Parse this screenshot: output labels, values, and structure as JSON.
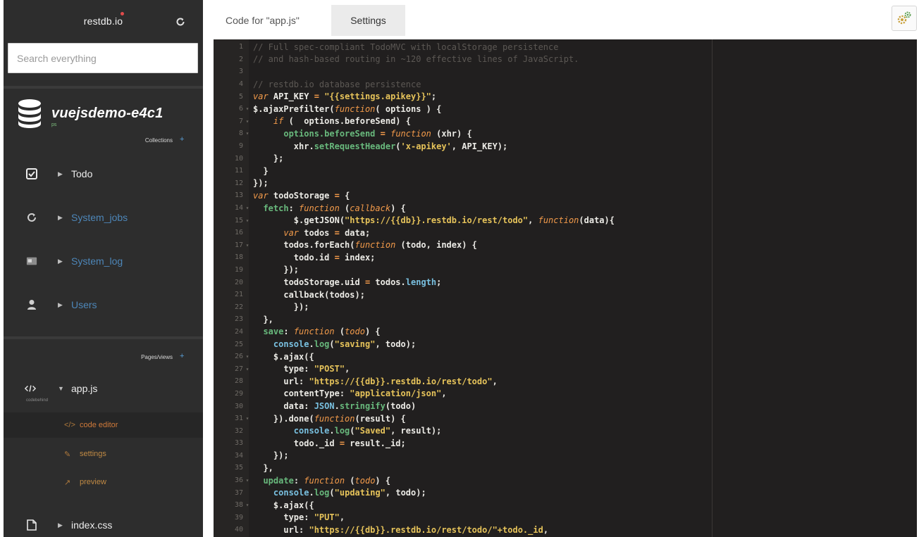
{
  "sidebar": {
    "brand": "restdb.io",
    "search_placeholder": "Search everything",
    "database": {
      "name": "vuejsdemo-e4c1",
      "sub": "ps"
    },
    "collections_label": "Collections",
    "collections": [
      {
        "label": "Todo",
        "icon": "checkbox-icon",
        "dim": false
      },
      {
        "label": "System_jobs",
        "icon": "refresh-icon",
        "dim": true
      },
      {
        "label": "System_log",
        "icon": "log-icon",
        "dim": true
      },
      {
        "label": "Users",
        "icon": "user-icon",
        "dim": true
      }
    ],
    "pages_label": "Pages/views",
    "page": {
      "label": "app.js",
      "sub": "codebehind",
      "icon": "code-icon"
    },
    "page_subitems": [
      {
        "label": "code editor",
        "icon": "code-small-icon",
        "glyph": "</>",
        "active": true
      },
      {
        "label": "settings",
        "icon": "wrench-icon",
        "glyph": "✎",
        "active": false
      },
      {
        "label": "preview",
        "icon": "external-link-icon",
        "glyph": "↗",
        "active": false
      }
    ],
    "file": {
      "label": "index.css",
      "icon": "file-icon"
    }
  },
  "tabs": [
    {
      "label": "Code for \"app.js\"",
      "active": false
    },
    {
      "label": "Settings",
      "active": true
    }
  ],
  "toolbar": {
    "icon": "gears-icon"
  },
  "editor": {
    "lines": [
      [
        [
          "t-comment",
          "// Full spec-compliant TodoMVC with localStorage persistence"
        ]
      ],
      [
        [
          "t-comment",
          "// and hash-based routing in ~120 effective lines of JavaScript."
        ]
      ],
      [],
      [
        [
          "t-comment",
          "// restdb.io database persistence"
        ]
      ],
      [
        [
          "t-keyword",
          "var"
        ],
        [
          "t-plain",
          " API_KEY "
        ],
        [
          "t-op",
          "="
        ],
        [
          "t-plain",
          " "
        ],
        [
          "t-string",
          "\"{{settings.apikey}}\""
        ],
        [
          "t-plain",
          ";"
        ]
      ],
      [
        [
          "t-plain",
          "$.ajaxPrefilter("
        ],
        [
          "t-keyword",
          "function"
        ],
        [
          "t-plain",
          "( options ) {"
        ]
      ],
      [
        [
          "t-plain",
          "    "
        ],
        [
          "t-keyword",
          "if"
        ],
        [
          "t-plain",
          " (  options.beforeSend) {"
        ]
      ],
      [
        [
          "t-plain",
          "      "
        ],
        [
          "t-prop",
          "options.beforeSend"
        ],
        [
          "t-plain",
          " "
        ],
        [
          "t-op",
          "="
        ],
        [
          "t-plain",
          " "
        ],
        [
          "t-keyword",
          "function"
        ],
        [
          "t-plain",
          " (xhr) {"
        ]
      ],
      [
        [
          "t-plain",
          "        xhr."
        ],
        [
          "t-prop",
          "setRequestHeader"
        ],
        [
          "t-plain",
          "("
        ],
        [
          "t-string",
          "'x-apikey'"
        ],
        [
          "t-plain",
          ", API_KEY);"
        ]
      ],
      [
        [
          "t-plain",
          "    };"
        ]
      ],
      [
        [
          "t-plain",
          "  }"
        ]
      ],
      [
        [
          "t-plain",
          "});"
        ]
      ],
      [
        [
          "t-keyword",
          "var"
        ],
        [
          "t-plain",
          " todoStorage "
        ],
        [
          "t-op",
          "="
        ],
        [
          "t-plain",
          " {"
        ]
      ],
      [
        [
          "t-plain",
          "  "
        ],
        [
          "t-prop",
          "fetch"
        ],
        [
          "t-plain",
          ": "
        ],
        [
          "t-keyword",
          "function"
        ],
        [
          "t-plain",
          " ("
        ],
        [
          "t-keyword",
          "callback"
        ],
        [
          "t-plain",
          ") {"
        ]
      ],
      [
        [
          "t-plain",
          "        $.getJSON("
        ],
        [
          "t-string",
          "\"https://{{db}}.restdb.io/rest/todo\""
        ],
        [
          "t-plain",
          ", "
        ],
        [
          "t-keyword",
          "function"
        ],
        [
          "t-plain",
          "(data){"
        ]
      ],
      [
        [
          "t-plain",
          "      "
        ],
        [
          "t-keyword",
          "var"
        ],
        [
          "t-plain",
          " todos "
        ],
        [
          "t-op",
          "="
        ],
        [
          "t-plain",
          " data;"
        ]
      ],
      [
        [
          "t-plain",
          "      todos.forEach("
        ],
        [
          "t-keyword",
          "function"
        ],
        [
          "t-plain",
          " (todo, index) {"
        ]
      ],
      [
        [
          "t-plain",
          "        todo.id "
        ],
        [
          "t-op",
          "="
        ],
        [
          "t-plain",
          " index;"
        ]
      ],
      [
        [
          "t-plain",
          "      });"
        ]
      ],
      [
        [
          "t-plain",
          "      todoStorage.uid "
        ],
        [
          "t-op",
          "="
        ],
        [
          "t-plain",
          " todos."
        ],
        [
          "t-fn",
          "length"
        ],
        [
          "t-plain",
          ";"
        ]
      ],
      [
        [
          "t-plain",
          "      callback(todos);"
        ]
      ],
      [
        [
          "t-plain",
          "        });"
        ]
      ],
      [
        [
          "t-plain",
          "  },"
        ]
      ],
      [
        [
          "t-plain",
          "  "
        ],
        [
          "t-prop",
          "save"
        ],
        [
          "t-plain",
          ": "
        ],
        [
          "t-keyword",
          "function"
        ],
        [
          "t-plain",
          " ("
        ],
        [
          "t-keyword",
          "todo"
        ],
        [
          "t-plain",
          ") {"
        ]
      ],
      [
        [
          "t-plain",
          "    "
        ],
        [
          "t-fn",
          "console"
        ],
        [
          "t-plain",
          "."
        ],
        [
          "t-prop",
          "log"
        ],
        [
          "t-plain",
          "("
        ],
        [
          "t-string",
          "\"saving\""
        ],
        [
          "t-plain",
          ", todo);"
        ]
      ],
      [
        [
          "t-plain",
          "    $.ajax({"
        ]
      ],
      [
        [
          "t-plain",
          "      type: "
        ],
        [
          "t-string",
          "\"POST\""
        ],
        [
          "t-plain",
          ","
        ]
      ],
      [
        [
          "t-plain",
          "      url: "
        ],
        [
          "t-string",
          "\"https://{{db}}.restdb.io/rest/todo\""
        ],
        [
          "t-plain",
          ","
        ]
      ],
      [
        [
          "t-plain",
          "      contentType: "
        ],
        [
          "t-string",
          "\"application/json\""
        ],
        [
          "t-plain",
          ","
        ]
      ],
      [
        [
          "t-plain",
          "      data: "
        ],
        [
          "t-fn",
          "JSON"
        ],
        [
          "t-plain",
          "."
        ],
        [
          "t-prop",
          "stringify"
        ],
        [
          "t-plain",
          "(todo)"
        ]
      ],
      [
        [
          "t-plain",
          "    }).done("
        ],
        [
          "t-keyword",
          "function"
        ],
        [
          "t-plain",
          "(result) {"
        ]
      ],
      [
        [
          "t-plain",
          "        "
        ],
        [
          "t-fn",
          "console"
        ],
        [
          "t-plain",
          "."
        ],
        [
          "t-prop",
          "log"
        ],
        [
          "t-plain",
          "("
        ],
        [
          "t-string",
          "\"Saved\""
        ],
        [
          "t-plain",
          ", result);"
        ]
      ],
      [
        [
          "t-plain",
          "        todo._id "
        ],
        [
          "t-op",
          "="
        ],
        [
          "t-plain",
          " result._id;"
        ]
      ],
      [
        [
          "t-plain",
          "    });"
        ]
      ],
      [
        [
          "t-plain",
          "  },"
        ]
      ],
      [
        [
          "t-plain",
          "  "
        ],
        [
          "t-prop",
          "update"
        ],
        [
          "t-plain",
          ": "
        ],
        [
          "t-keyword",
          "function"
        ],
        [
          "t-plain",
          " ("
        ],
        [
          "t-keyword",
          "todo"
        ],
        [
          "t-plain",
          ") {"
        ]
      ],
      [
        [
          "t-plain",
          "    "
        ],
        [
          "t-fn",
          "console"
        ],
        [
          "t-plain",
          "."
        ],
        [
          "t-prop",
          "log"
        ],
        [
          "t-plain",
          "("
        ],
        [
          "t-string",
          "\"updating\""
        ],
        [
          "t-plain",
          ", todo);"
        ]
      ],
      [
        [
          "t-plain",
          "    $.ajax({"
        ]
      ],
      [
        [
          "t-plain",
          "      type: "
        ],
        [
          "t-string",
          "\"PUT\""
        ],
        [
          "t-plain",
          ","
        ]
      ],
      [
        [
          "t-plain",
          "      url: "
        ],
        [
          "t-string",
          "\"https://{{db}}.restdb.io/rest/todo/\"+todo._id"
        ],
        [
          "t-plain",
          ","
        ]
      ]
    ],
    "fold_lines": [
      6,
      7,
      8,
      14,
      15,
      17,
      26,
      27,
      31,
      36,
      38
    ]
  }
}
